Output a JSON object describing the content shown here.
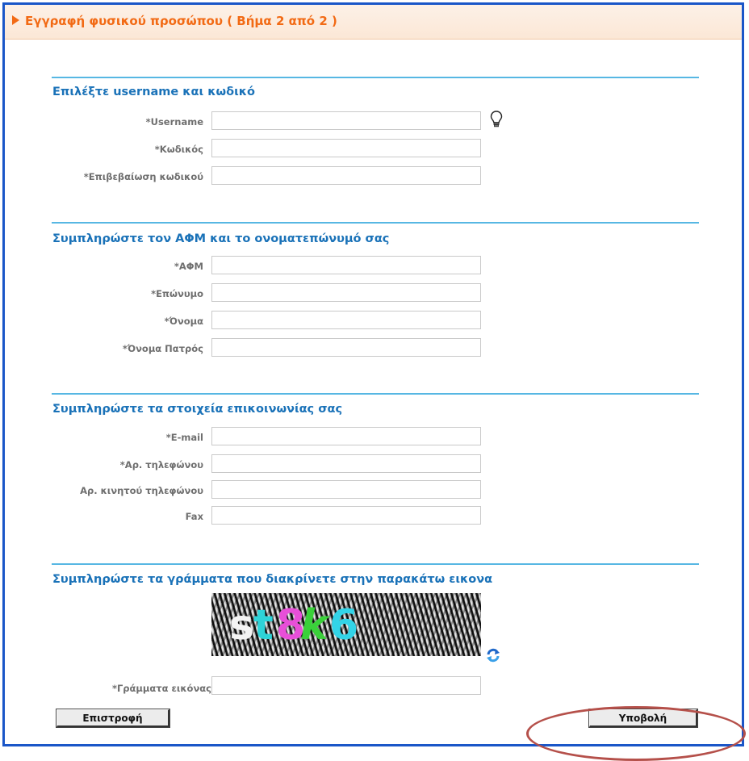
{
  "header": {
    "title": "Εγγραφή φυσικού προσώπου ( Βήμα 2 από 2 )"
  },
  "sections": {
    "account": {
      "title": "Επιλέξτε username και κωδικό",
      "username_label": "*Username",
      "password_label": "*Κωδικός",
      "confirm_label": "*Επιβεβαίωση κωδικού"
    },
    "identity": {
      "title": "Συμπληρώστε τον ΑΦΜ και το ονοματεπώνυμό σας",
      "afm_label": "*ΑΦΜ",
      "surname_label": "*Επώνυμο",
      "name_label": "*Όνομα",
      "father_label": "*Όνομα Πατρός"
    },
    "contact": {
      "title": "Συμπληρώστε τα στοιχεία επικοινωνίας σας",
      "email_label": "*E-mail",
      "phone_label": "*Αρ. τηλεφώνου",
      "mobile_label": "Αρ. κινητού τηλεφώνου",
      "fax_label": "Fax"
    },
    "captcha": {
      "title": "Συμπληρώστε τα γράμματα που διακρίνετε στην παρακάτω εικονα",
      "chars": [
        "s",
        "t",
        "8",
        "k",
        "6"
      ],
      "char_colors": [
        "#f4f4f4",
        "#2ed3d8",
        "#e84fd8",
        "#3ad13a",
        "#32d4e8"
      ],
      "input_label": "*Γράμματα εικόνας"
    }
  },
  "buttons": {
    "back": "Επιστροφή",
    "submit": "Υποβολή"
  },
  "icons": {
    "hint": "lightbulb-icon",
    "refresh": "refresh-icon"
  },
  "colors": {
    "frame": "#1a56c8",
    "header_text": "#f26a14",
    "section_title": "#1a72b8",
    "divider": "#57b7e3",
    "highlight": "#b5504a"
  }
}
